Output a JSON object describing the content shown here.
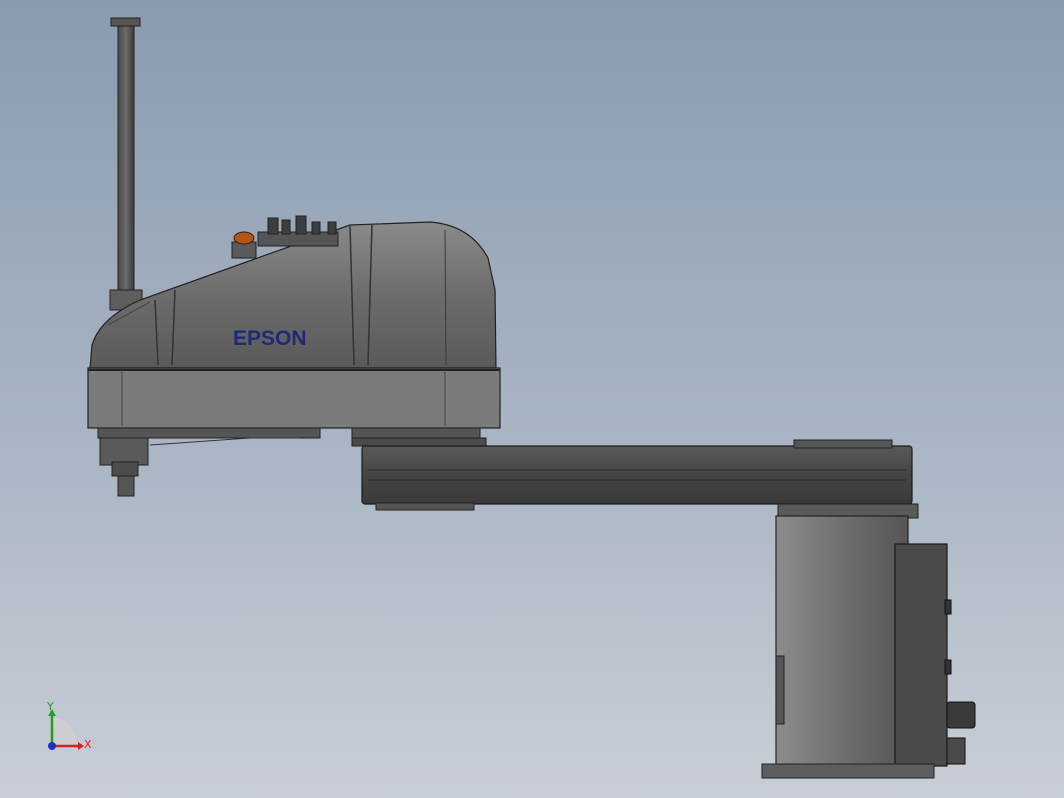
{
  "model": {
    "brand_text": "EPSON",
    "brand_color": "#1e2a78",
    "body_color": "#6e6e6e",
    "arm_color": "#4a4a4a",
    "background_top": "#8a9bb0",
    "background_bottom": "#c9ced6",
    "lamp_color": "#b0561a"
  },
  "triad": {
    "x_label": "X",
    "y_label": "Y",
    "x_color": "#d42020",
    "y_color": "#20a020",
    "z_color": "#2030c0"
  }
}
